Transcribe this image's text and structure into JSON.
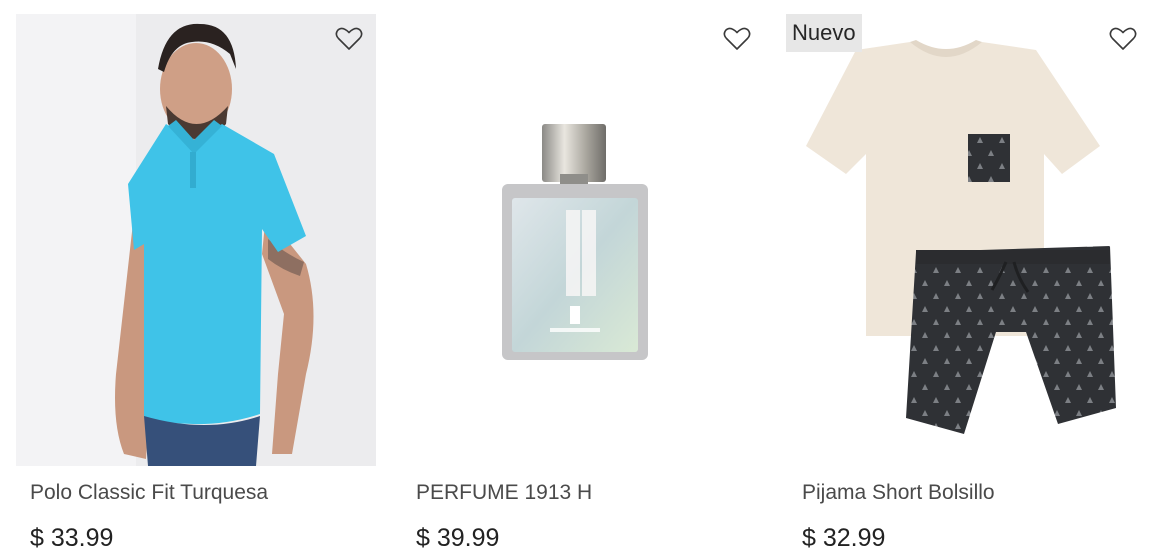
{
  "products": [
    {
      "name": "Polo Classic Fit Turquesa",
      "price": "$ 33.99",
      "badge": ""
    },
    {
      "name": "PERFUME 1913 H",
      "price": "$ 39.99",
      "badge": ""
    },
    {
      "name": "Pijama Short Bolsillo",
      "price": "$ 32.99",
      "badge": "Nuevo"
    }
  ],
  "icons": {
    "favorite": "heart-outline-icon"
  },
  "colors": {
    "polo": "#3fc3e8",
    "shorts": "#2f3135",
    "tee": "#efe6d9"
  }
}
